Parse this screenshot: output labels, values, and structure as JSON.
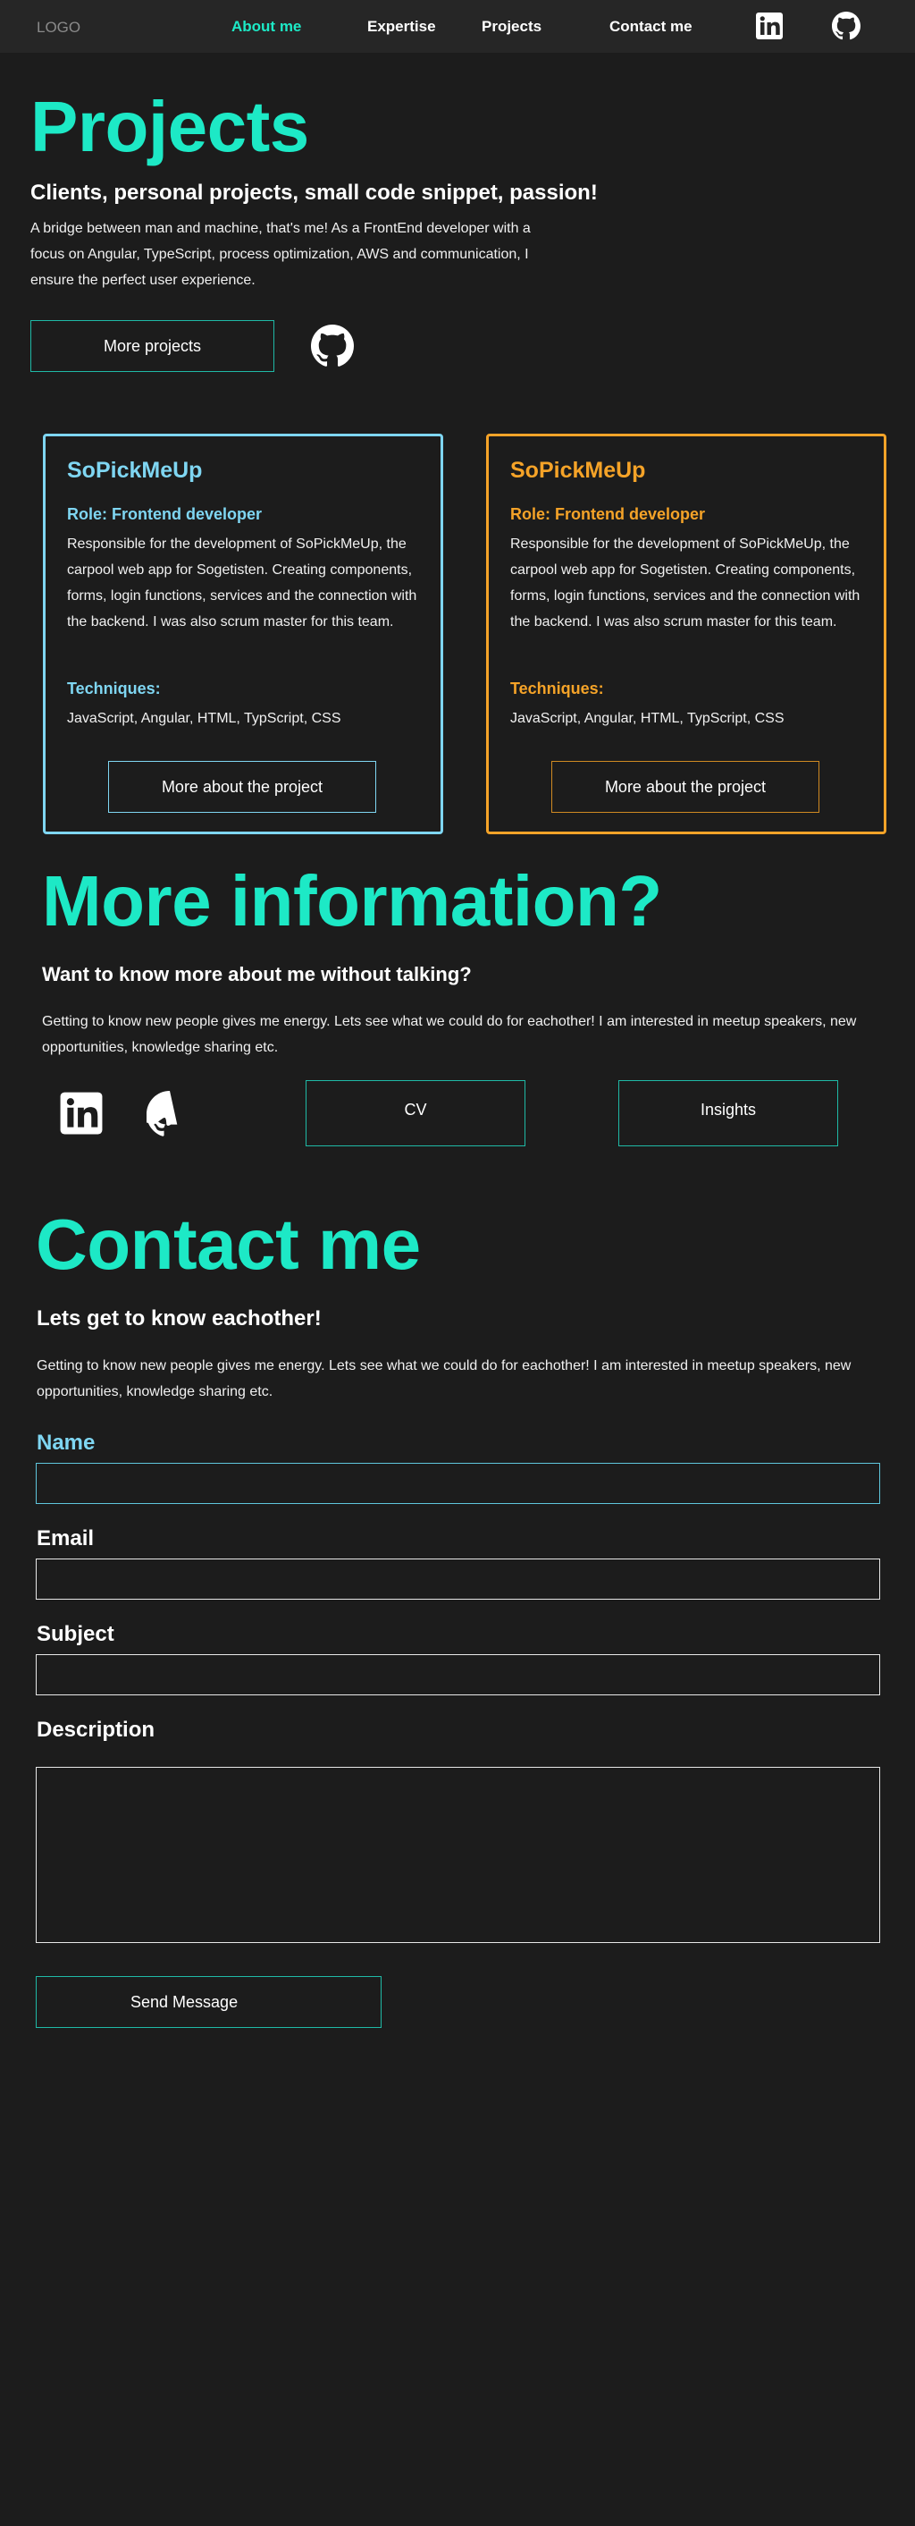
{
  "nav": {
    "logo": "LOGO",
    "links": [
      "About me",
      "Expertise",
      "Projects",
      "Contact me"
    ],
    "icons": [
      "linkedin-icon",
      "github-icon"
    ]
  },
  "projects": {
    "title": "Projects",
    "subtitle": "Clients, personal projects, small code snippet, passion!",
    "body": "A bridge between man and machine, that's me! As a FrontEnd developer with a focus on Angular, TypeScript, process optimization, AWS and communication, I ensure the perfect user experience.",
    "more_button": "More projects",
    "cards": [
      {
        "title": "SoPickMeUp",
        "role": "Role: Frontend developer",
        "description": "Responsible for the development of SoPickMeUp, the carpool web app for Sogetisten. Creating components, forms, login functions, services and the connection with the backend. I was also scrum master for this team.",
        "techniques_label": "Techniques:",
        "techniques": "JavaScript, Angular, HTML, TypScript, CSS",
        "button": "More about the project",
        "accent": "#7fd6f2"
      },
      {
        "title": "SoPickMeUp",
        "role": "Role: Frontend developer",
        "description": "Responsible for the development of SoPickMeUp, the carpool web app for Sogetisten. Creating components, forms, login functions, services and the connection with the backend. I was also scrum master for this team.",
        "techniques_label": "Techniques:",
        "techniques": "JavaScript, Angular, HTML, TypScript, CSS",
        "button": "More about the project",
        "accent": "#f5a328"
      }
    ]
  },
  "more_info": {
    "title": "More information?",
    "subtitle": "Want to know more about me without talking?",
    "body": "Getting to know new people gives me energy. Lets see what we could do for eachother! I am interested in meetup speakers, new opportunities, knowledge sharing etc.",
    "cv_button": "CV",
    "insights_button": "Insights"
  },
  "contact": {
    "title": "Contact me",
    "subtitle": "Lets get to know eachother!",
    "body": "Getting to know new people gives me energy. Lets see what we could do for eachother! I am interested in meetup speakers, new opportunities, knowledge sharing etc.",
    "fields": {
      "name_label": "Name",
      "email_label": "Email",
      "subject_label": "Subject",
      "description_label": "Description"
    },
    "send_button": "Send Message"
  },
  "colors": {
    "accent": "#1de9c6",
    "background": "#1c1c1c",
    "nav_background": "#262626",
    "card_blue": "#7fd6f2",
    "card_orange": "#f5a328"
  }
}
